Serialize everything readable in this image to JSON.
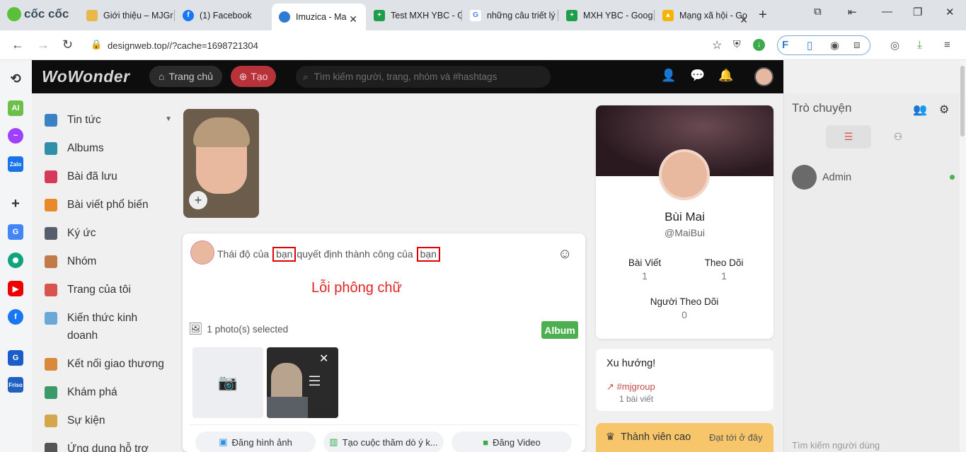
{
  "browser": {
    "brand": "cốc cốc",
    "tabs": [
      {
        "title": "Giới thiệu – MJGr",
        "color": "#e9b84a"
      },
      {
        "title": "(1) Facebook",
        "color": "#1877f2"
      },
      {
        "title": "Imuzica - Ma",
        "color": "#2e7bd1",
        "active": true
      },
      {
        "title": "Test MXH YBC - G",
        "color": "#1e9e4a"
      },
      {
        "title": "những câu triết lý",
        "color": "#4285f4"
      },
      {
        "title": "MXH YBC - Goog",
        "color": "#1e9e4a"
      },
      {
        "title": "Mạng xã hội - Go",
        "color": "#f4b400"
      }
    ],
    "url": "designweb.top//?cache=1698721304"
  },
  "app": {
    "logo": "WoWonder",
    "home_label": "Trang chủ",
    "create_label": "Tạo",
    "search_placeholder": "Tìm kiếm người, trang, nhóm và #hashtags"
  },
  "menu": [
    {
      "label": "Tin tức",
      "icon": "news-icon",
      "color": "#3b82c4"
    },
    {
      "label": "Albums",
      "icon": "albums-icon",
      "color": "#2f8fa8"
    },
    {
      "label": "Bài đã lưu",
      "icon": "bookmark-icon",
      "color": "#d63a5a"
    },
    {
      "label": "Bài viết phổ biến",
      "icon": "popular-icon",
      "color": "#e88a2a"
    },
    {
      "label": "Ký ức",
      "icon": "memories-icon",
      "color": "#555e6a"
    },
    {
      "label": "Nhóm",
      "icon": "groups-icon",
      "color": "#c27a4a"
    },
    {
      "label": "Trang của tôi",
      "icon": "pages-icon",
      "color": "#d9534f"
    },
    {
      "label": "Kiến thức kinh doanh",
      "icon": "knowledge-icon",
      "color": "#6aa8d8"
    },
    {
      "label": "Kết nối giao thương",
      "icon": "connect-icon",
      "color": "#d88a3a"
    },
    {
      "label": "Khám phá",
      "icon": "explore-icon",
      "color": "#3a9a6a"
    },
    {
      "label": "Sự kiện",
      "icon": "events-icon",
      "color": "#d4a84a"
    },
    {
      "label": "Ứng dụng hỗ trợ",
      "icon": "apps-icon",
      "color": "#555"
    }
  ],
  "composer": {
    "text_before": "Thái độ của",
    "word1": "bạn",
    "text_middle": "quyết định thành công của",
    "word2": "bạn",
    "error_note": "Lỗi phông chữ",
    "photo_count": "1 photo(s) selected",
    "album_label": "Album",
    "actions": [
      "Đăng hình ảnh",
      "Tạo cuộc thăm dò ý k...",
      "Đăng Video"
    ]
  },
  "profile": {
    "name": "Bùi Mai",
    "handle": "@MaiBui",
    "stats": [
      {
        "label": "Bài Viết",
        "value": "1"
      },
      {
        "label": "Theo Dõi",
        "value": "1"
      },
      {
        "label": "Người Theo Dõi",
        "value": "0"
      }
    ]
  },
  "trending": {
    "title": "Xu hướng!",
    "tag": "#mjgroup",
    "count": "1 bài viết"
  },
  "pro": {
    "title": "Thành viên cao",
    "link": "Đạt tới ở đây"
  },
  "chat": {
    "title": "Trò chuyện",
    "user": "Admin",
    "search_placeholder": "Tìm kiếm người dùng"
  }
}
